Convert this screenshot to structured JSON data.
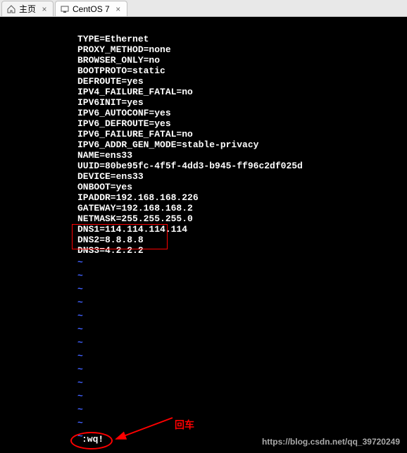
{
  "tabs": {
    "tab1": {
      "label": "主页"
    },
    "tab2": {
      "label": "CentOS 7"
    }
  },
  "config": {
    "line0": "TYPE=Ethernet",
    "line1": "PROXY_METHOD=none",
    "line2": "BROWSER_ONLY=no",
    "line3": "BOOTPROTO=static",
    "line4": "DEFROUTE=yes",
    "line5": "IPV4_FAILURE_FATAL=no",
    "line6": "IPV6INIT=yes",
    "line7": "IPV6_AUTOCONF=yes",
    "line8": "IPV6_DEFROUTE=yes",
    "line9": "IPV6_FAILURE_FATAL=no",
    "line10": "IPV6_ADDR_GEN_MODE=stable-privacy",
    "line11": "NAME=ens33",
    "line12": "UUID=80be95fc-4f5f-4dd3-b945-ff96c2df025d",
    "line13": "DEVICE=ens33",
    "line14": "ONBOOT=yes",
    "line15": "IPADDR=192.168.168.226",
    "line16": "GATEWAY=192.168.168.2",
    "line17": "NETMASK=255.255.255.0",
    "line18": "DNS1=114.114.114.114",
    "line19": "DNS2=8.8.8.8",
    "line20": "DNS3=4.2.2.2"
  },
  "tilde": "~",
  "vim": {
    "command": ":wq!"
  },
  "annotation": {
    "text": "回车"
  },
  "watermark": "https://blog.csdn.net/qq_39720249",
  "tab_close": "×"
}
